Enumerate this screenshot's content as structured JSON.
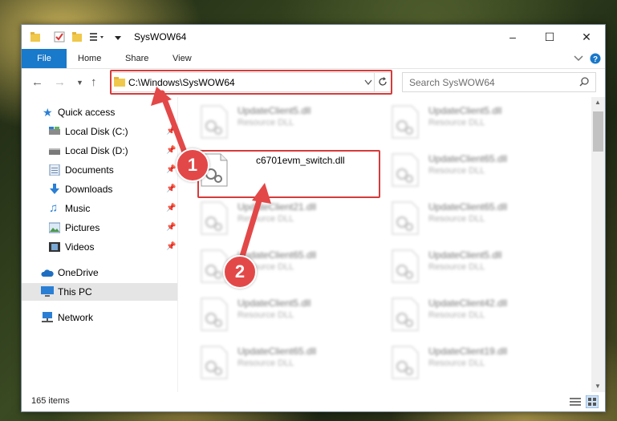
{
  "window": {
    "title": "SysWOW64",
    "minimize": "–",
    "maximize": "☐",
    "close": "✕"
  },
  "ribbon": {
    "tabs": [
      "File",
      "Home",
      "Share",
      "View"
    ]
  },
  "address": {
    "path": "C:\\Windows\\SysWOW64"
  },
  "search": {
    "placeholder": "Search SysWOW64"
  },
  "nav": {
    "items": [
      {
        "label": "Quick access",
        "icon": "star-icon"
      },
      {
        "label": "Local Disk (C:)",
        "icon": "drive-icon"
      },
      {
        "label": "Local Disk (D:)",
        "icon": "drive-icon"
      },
      {
        "label": "Documents",
        "icon": "documents-icon"
      },
      {
        "label": "Downloads",
        "icon": "download-icon"
      },
      {
        "label": "Music",
        "icon": "music-icon"
      },
      {
        "label": "Pictures",
        "icon": "pictures-icon"
      },
      {
        "label": "Videos",
        "icon": "videos-icon"
      },
      {
        "label": "OneDrive",
        "icon": "cloud-icon"
      },
      {
        "label": "This PC",
        "icon": "computer-icon"
      },
      {
        "label": "Network",
        "icon": "network-icon"
      }
    ]
  },
  "files": [
    {
      "name": "UpdateClient5.dll",
      "type": "Resource DLL"
    },
    {
      "name": "UpdateClient5.dll",
      "type": "Resource DLL"
    },
    {
      "name": "c6701evm_switch.dll",
      "type": ""
    },
    {
      "name": "UpdateClient65.dll",
      "type": "Resource DLL"
    },
    {
      "name": "UpdateClient21.dll",
      "type": "Resource DLL"
    },
    {
      "name": "UpdateClient65.dll",
      "type": "Resource DLL"
    },
    {
      "name": "UpdateClient65.dll",
      "type": "Resource DLL"
    },
    {
      "name": "UpdateClient5.dll",
      "type": "Resource DLL"
    },
    {
      "name": "UpdateClient5.dll",
      "type": "Resource DLL"
    },
    {
      "name": "UpdateClient42.dll",
      "type": "Resource DLL"
    },
    {
      "name": "UpdateClient65.dll",
      "type": "Resource DLL"
    },
    {
      "name": "UpdateClient19.dll",
      "type": "Resource DLL"
    }
  ],
  "status": {
    "item_count": "165 items"
  },
  "annotations": {
    "badge1": "1",
    "badge2": "2",
    "color": "#e34848"
  },
  "colors": {
    "file_tab": "#1979ca",
    "selected_nav": "#e5e5e5"
  }
}
